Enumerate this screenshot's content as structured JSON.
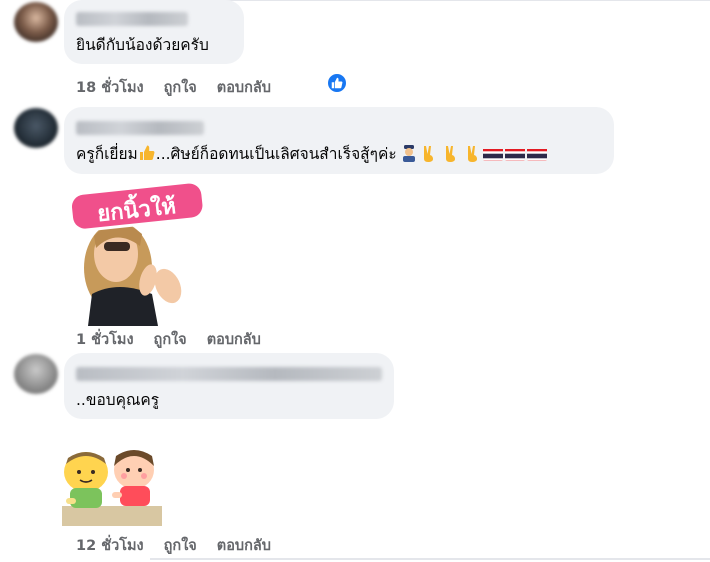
{
  "comments": [
    {
      "text": "ยินดีกับน้องด้วยครับ",
      "time": "18 ชั่วโมง",
      "like": "ถูกใจ",
      "reply": "ตอบกลับ",
      "reaction": "like-icon"
    },
    {
      "text": "ครูก็เยี่ยม",
      "text2": "...ศิษย์ก็อดทนเป็นเลิศจนสำเร็จสู้ๆค่ะ",
      "sticker_text": "ยกนิ้วให้",
      "time": "1 ชั่วโมง",
      "like": "ถูกใจ",
      "reply": "ตอบกลับ"
    },
    {
      "text": "..ขอบคุณครู",
      "time": "12 ชั่วโมง",
      "like": "ถูกใจ",
      "reply": "ตอบกลับ"
    }
  ],
  "colors": {
    "bubble": "#f0f2f5",
    "meta": "#65676b",
    "like_blue": "#1877f2"
  }
}
